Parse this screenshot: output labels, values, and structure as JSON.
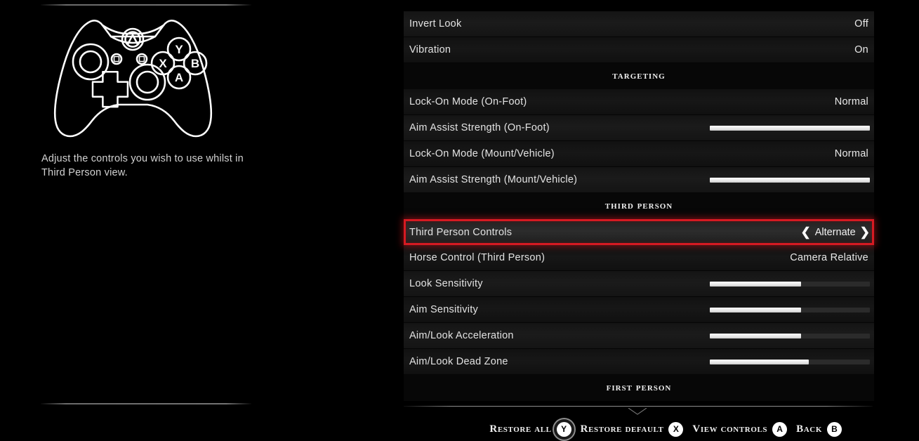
{
  "left": {
    "controller_icon": "xbox-controller-outline",
    "helper_text": "Adjust the controls you wish to use whilst in Third Person view.",
    "controller_buttons": {
      "y": "Y",
      "x": "X",
      "b": "B",
      "a": "A"
    }
  },
  "menu": {
    "rows": [
      {
        "type": "option",
        "label": "Invert Look",
        "value": "Off"
      },
      {
        "type": "option",
        "label": "Vibration",
        "value": "On"
      },
      {
        "type": "header",
        "label": "Targeting"
      },
      {
        "type": "option",
        "label": "Lock-On Mode (On-Foot)",
        "value": "Normal"
      },
      {
        "type": "slider",
        "label": "Aim Assist Strength (On-Foot)",
        "fill": 100
      },
      {
        "type": "option",
        "label": "Lock-On Mode (Mount/Vehicle)",
        "value": "Normal"
      },
      {
        "type": "slider",
        "label": "Aim Assist Strength (Mount/Vehicle)",
        "fill": 100
      },
      {
        "type": "header",
        "label": "Third Person"
      },
      {
        "type": "stepper",
        "label": "Third Person Controls",
        "value": "Alternate",
        "selected": true,
        "left_arrow": "chevron-left",
        "right_arrow": "chevron-right"
      },
      {
        "type": "option",
        "label": "Horse Control (Third Person)",
        "value": "Camera Relative"
      },
      {
        "type": "slider",
        "label": "Look Sensitivity",
        "fill": 57
      },
      {
        "type": "slider",
        "label": "Aim Sensitivity",
        "fill": 57
      },
      {
        "type": "slider",
        "label": "Aim/Look Acceleration",
        "fill": 57
      },
      {
        "type": "slider",
        "label": "Aim/Look Dead Zone",
        "fill": 62
      },
      {
        "type": "header",
        "label": "First Person"
      }
    ]
  },
  "bottom_bar": {
    "prompts": [
      {
        "label": "Restore All",
        "button": "Y",
        "highlighted": true
      },
      {
        "label": "Restore Default",
        "button": "X",
        "highlighted": false
      },
      {
        "label": "View Controls",
        "button": "A",
        "highlighted": false
      },
      {
        "label": "Back",
        "button": "B",
        "highlighted": false
      }
    ]
  },
  "colors": {
    "highlight_red": "#d61a22",
    "slider_fill": "#ffffff",
    "slider_track": "#2b2b2b",
    "row_bg": "#171717",
    "background": "#000000"
  }
}
